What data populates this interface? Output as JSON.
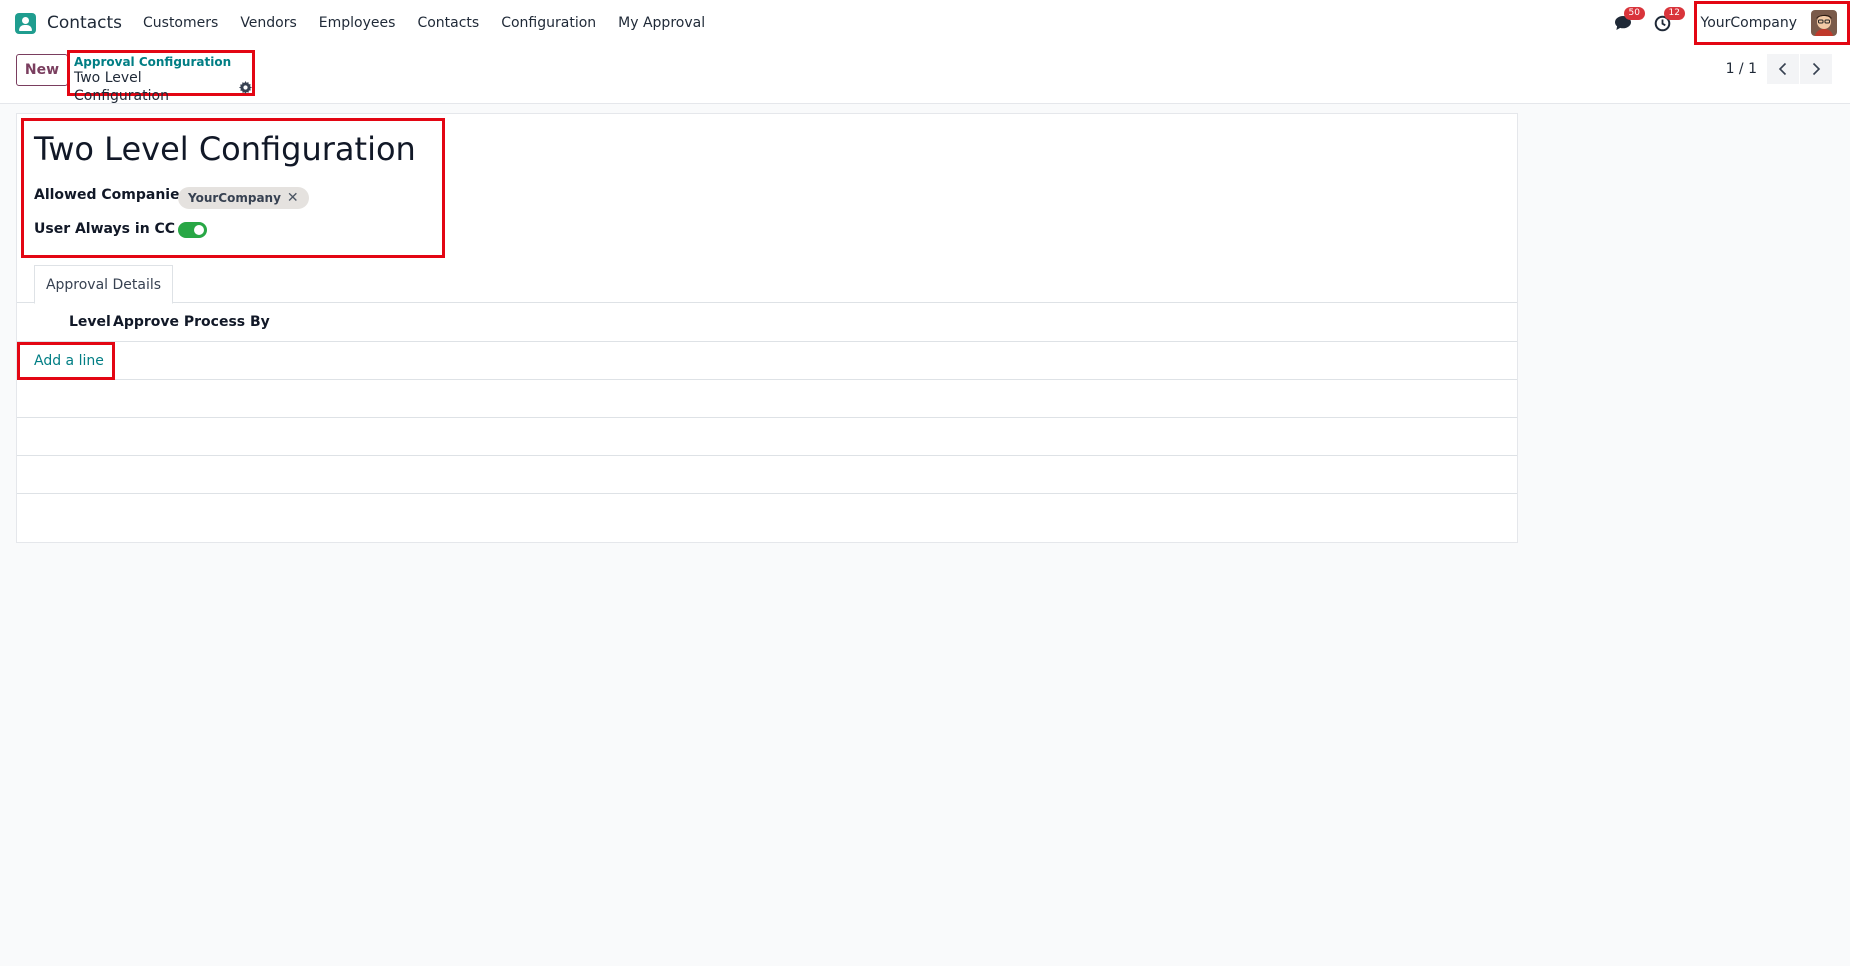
{
  "navbar": {
    "app_name": "Contacts",
    "menu": [
      "Customers",
      "Vendors",
      "Employees",
      "Contacts",
      "Configuration",
      "My Approval"
    ],
    "messages_count": "50",
    "activities_count": "12",
    "company": "YourCompany"
  },
  "control_panel": {
    "new_label": "New",
    "breadcrumb_parent": "Approval Configuration",
    "breadcrumb_current": "Two Level Configuration",
    "pager": "1 / 1"
  },
  "form": {
    "title": "Two Level Configuration",
    "allowed_companies_label": "Allowed Companies",
    "allowed_companies_tag": "YourCompany",
    "tag_remove": "✕",
    "user_cc_label": "User Always in CC",
    "user_cc_enabled": true,
    "tab_label": "Approval Details",
    "columns": [
      "Level",
      "Approve Process By"
    ],
    "add_line": "Add a line"
  },
  "colors": {
    "accent": "#017e84",
    "primary": "#7a3e5f",
    "toggle_on": "#28a745",
    "badge": "#d9343b",
    "highlight": "#e30613"
  }
}
